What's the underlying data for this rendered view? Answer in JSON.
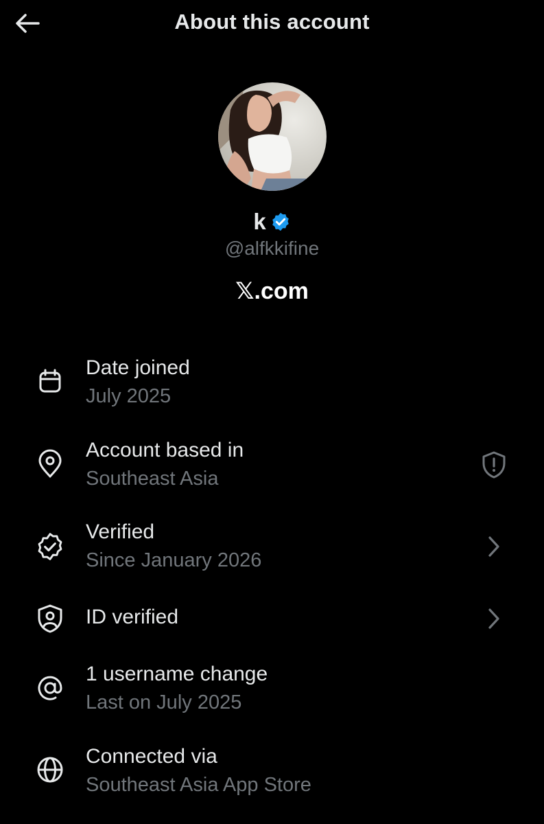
{
  "header": {
    "title": "About this account",
    "back_icon": "arrow-left-icon"
  },
  "profile": {
    "display_name": "k",
    "verified_badge_color": "#1d9bf0",
    "handle": "@alfkkifine",
    "site": "𝕏.com"
  },
  "details": [
    {
      "icon": "calendar-icon",
      "title": "Date joined",
      "subtitle": "July 2025"
    },
    {
      "icon": "location-pin-icon",
      "title": "Account based in",
      "subtitle": "Southeast Asia",
      "right_icon": "shield-alert-icon"
    },
    {
      "icon": "verified-badge-icon",
      "title": "Verified",
      "subtitle": "Since January 2026",
      "right_icon": "chevron-right-icon"
    },
    {
      "icon": "id-shield-icon",
      "title": "ID verified",
      "right_icon": "chevron-right-icon"
    },
    {
      "icon": "at-sign-icon",
      "title": "1 username change",
      "subtitle": "Last on July 2025"
    },
    {
      "icon": "globe-icon",
      "title": "Connected via",
      "subtitle": "Southeast Asia App Store"
    }
  ],
  "colors": {
    "background": "#000000",
    "primary_text": "#e7e9ea",
    "secondary_text": "#71767b",
    "accent": "#1d9bf0"
  }
}
